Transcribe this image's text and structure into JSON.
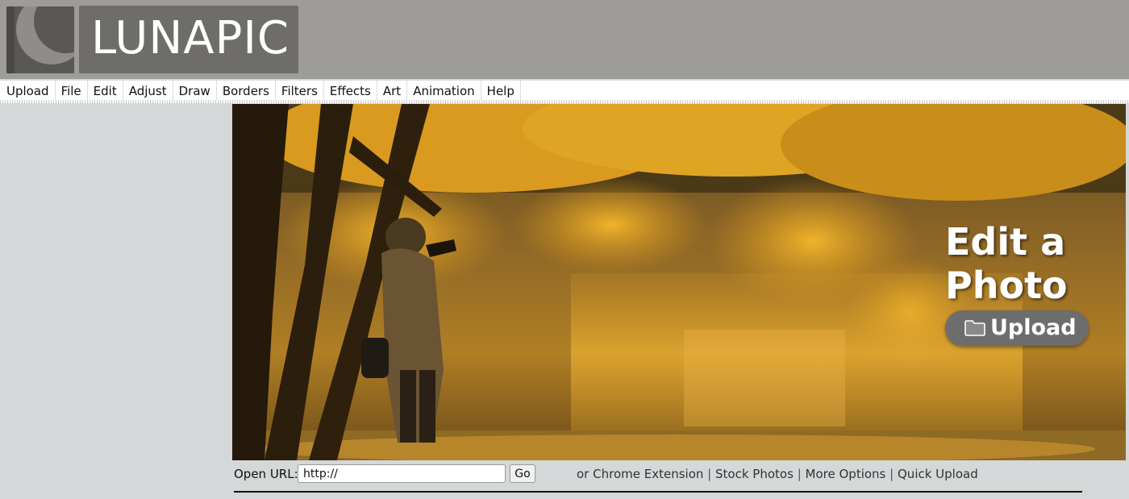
{
  "header": {
    "logo_icon": "crescent-moon-logo-icon",
    "logo_text": "LUNAPIC"
  },
  "menu": {
    "items": [
      "Upload",
      "File",
      "Edit",
      "Adjust",
      "Draw",
      "Borders",
      "Filters",
      "Effects",
      "Art",
      "Animation",
      "Help"
    ]
  },
  "hero": {
    "title_line1": "Edit a",
    "title_line2": "Photo",
    "upload_label": "Upload",
    "upload_icon": "folder-icon"
  },
  "url_bar": {
    "label": "Open URL:",
    "input_value": "http://",
    "go_label": "Go",
    "prefix": "or",
    "links": [
      "Chrome Extension",
      "Stock Photos",
      "More Options",
      "Quick Upload"
    ],
    "separator": "|"
  },
  "colors": {
    "header_bg": "#9d9c99",
    "page_bg": "#d4d8d9",
    "hero_accent": "#e0a020",
    "upload_button": "#6d6d6d"
  }
}
